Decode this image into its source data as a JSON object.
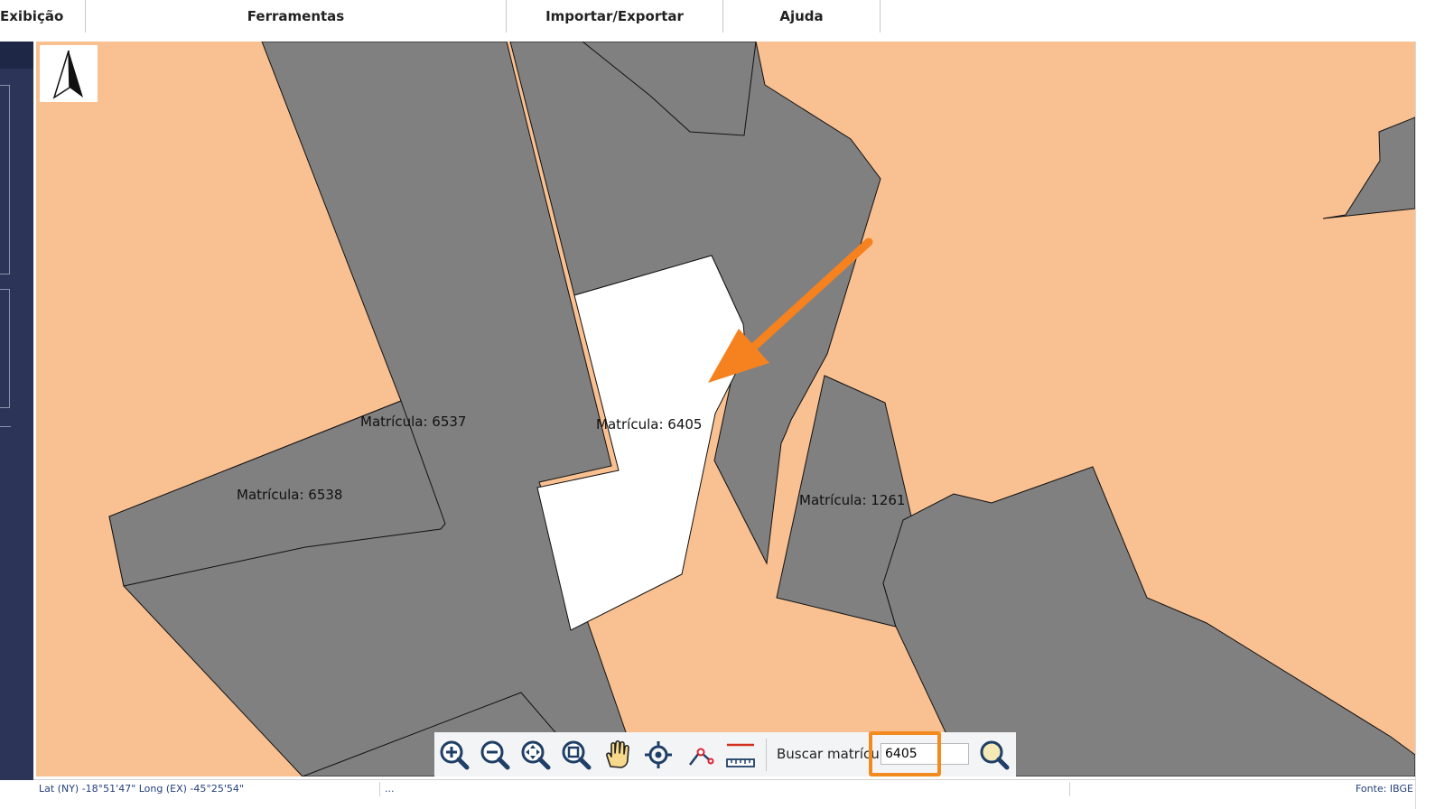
{
  "menu": {
    "items": [
      {
        "label": "Exibição"
      },
      {
        "label": "Ferramentas"
      },
      {
        "label": "Importar/Exportar"
      },
      {
        "label": "Ajuda"
      }
    ]
  },
  "map": {
    "north_arrow_icon": "north-arrow-icon",
    "parcels": [
      {
        "label": "Matrícula: 6537"
      },
      {
        "label": "Matrícula: 6405"
      },
      {
        "label": "Matrícula: 6538"
      },
      {
        "label": "Matrícula: 1261"
      }
    ],
    "colors": {
      "background": "#f9c091",
      "parcel": "#808080",
      "selected_parcel": "#ffffff",
      "arrow": "#f5821f"
    }
  },
  "toolbar": {
    "tools": [
      {
        "icon": "zoom-in-icon"
      },
      {
        "icon": "zoom-out-icon"
      },
      {
        "icon": "zoom-extent-icon"
      },
      {
        "icon": "zoom-window-icon"
      },
      {
        "icon": "pan-hand-icon"
      },
      {
        "icon": "locate-icon"
      },
      {
        "icon": "measure-distance-icon"
      },
      {
        "icon": "ruler-icon"
      }
    ],
    "search_label": "Buscar matrícula:",
    "search_value": "6405",
    "search_button_icon": "search-icon"
  },
  "status": {
    "coords": "Lat (NY) -18°51'47\" Long (EX) -45°25'54\"",
    "middle": "...",
    "source": "Fonte: IBGE"
  }
}
